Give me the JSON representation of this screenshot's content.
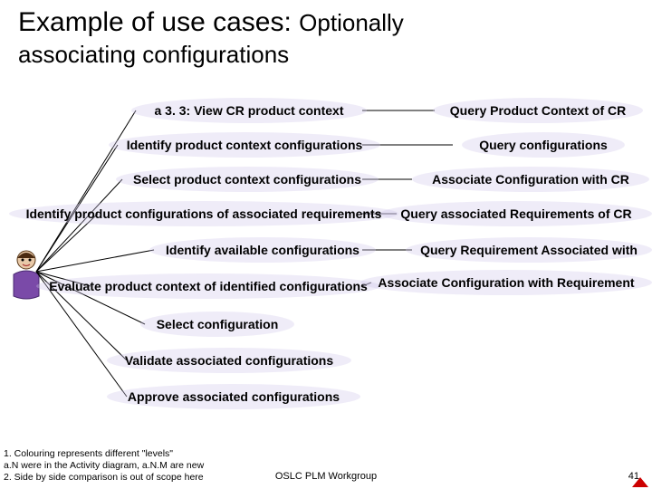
{
  "title_main": "Example of use cases:",
  "title_sub1": "Optionally",
  "title_sub2": "associating configurations",
  "left_bubbles": [
    "a 3. 3: View CR product context",
    "Identify product context configurations",
    "Select product context configurations",
    "Identify product configurations of associated requirements",
    "Identify available configurations",
    "Evaluate product context of identified configurations",
    "Select configuration",
    "Validate associated configurations",
    "Approve associated configurations"
  ],
  "right_bubbles": [
    "Query Product Context of CR",
    "Query configurations",
    "Associate Configuration with CR",
    "Query associated Requirements of CR",
    "Query Requirement Associated with",
    "Associate Configuration with Requirement"
  ],
  "footnotes": [
    "1. Colouring represents different \"levels\"",
    "a.N were in the Activity diagram, a.N.M are new",
    "2. Side by side comparison is out of scope here"
  ],
  "footer_center": "OSLC PLM Workgroup",
  "page_number": "41"
}
